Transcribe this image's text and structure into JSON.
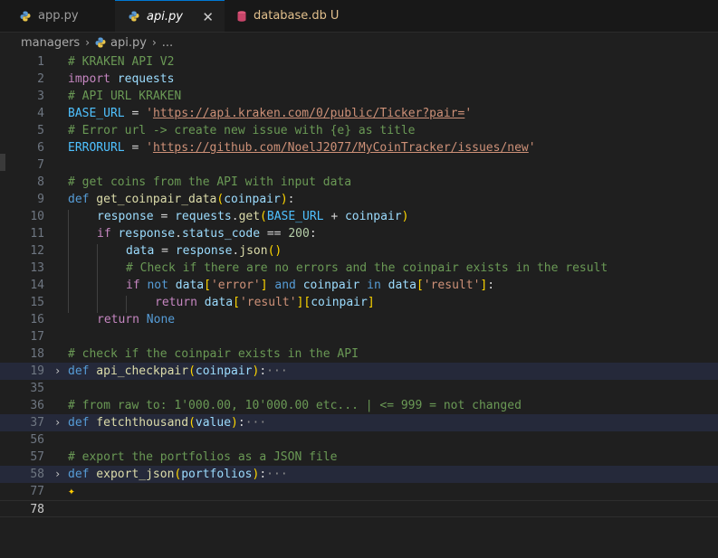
{
  "tabs": [
    {
      "label": "app.py",
      "icon": "python-icon"
    },
    {
      "label": "api.py",
      "icon": "python-icon",
      "close": "✕"
    },
    {
      "label": "database.db",
      "icon": "database-icon",
      "status": "U"
    }
  ],
  "breadcrumb": {
    "folder": "managers",
    "file": "api.py",
    "more": "..."
  },
  "lines": [
    {
      "n": "1"
    },
    {
      "n": "2"
    },
    {
      "n": "3"
    },
    {
      "n": "4"
    },
    {
      "n": "5"
    },
    {
      "n": "6"
    },
    {
      "n": "7"
    },
    {
      "n": "8"
    },
    {
      "n": "9"
    },
    {
      "n": "10"
    },
    {
      "n": "11"
    },
    {
      "n": "12"
    },
    {
      "n": "13"
    },
    {
      "n": "14"
    },
    {
      "n": "15"
    },
    {
      "n": "16"
    },
    {
      "n": "17"
    },
    {
      "n": "18"
    },
    {
      "n": "19"
    },
    {
      "n": "35"
    },
    {
      "n": "36"
    },
    {
      "n": "37"
    },
    {
      "n": "56"
    },
    {
      "n": "57"
    },
    {
      "n": "58"
    },
    {
      "n": "77"
    },
    {
      "n": "78"
    }
  ],
  "code": {
    "l1": "# KRAKEN API V2",
    "l2_kw": "import",
    "l2_mod": " requests",
    "l3": "# API URL KRAKEN",
    "l4_var": "BASE_URL",
    "l4_eq": " = ",
    "l4_q1": "'",
    "l4_url": "https://api.kraken.com/0/public/Ticker?pair=",
    "l4_q2": "'",
    "l5": "# Error url -> create new issue with {e} as title",
    "l6_var": "ERRORURL",
    "l6_eq": " = ",
    "l6_q1": "'",
    "l6_url": "https://github.com/NoelJ2077/MyCoinTracker/issues/new",
    "l6_q2": "'",
    "l8": "# get coins from the API with input data",
    "l9_def": "def",
    "l9_fn": " get_coinpair_data",
    "l9_p1": "(",
    "l9_arg": "coinpair",
    "l9_p2": ")",
    "l9_colon": ":",
    "l10_var": "response",
    "l10_eq": " = ",
    "l10_mod": "requests",
    "l10_dot": ".",
    "l10_fn": "get",
    "l10_p1": "(",
    "l10_cst": "BASE_URL",
    "l10_plus": " + ",
    "l10_arg": "coinpair",
    "l10_p2": ")",
    "l11_kw": "if",
    "l11_var": " response",
    "l11_dot": ".",
    "l11_attr": "status_code",
    "l11_eq": " == ",
    "l11_num": "200",
    "l11_colon": ":",
    "l12_var": "data",
    "l12_eq": " = ",
    "l12_obj": "response",
    "l12_dot": ".",
    "l12_fn": "json",
    "l12_p": "()",
    "l13": "# Check if there are no errors and the coinpair exists in the result",
    "l14_kw": "if",
    "l14_not": " not",
    "l14_data": " data",
    "l14_b1": "[",
    "l14_s1": "'error'",
    "l14_b2": "]",
    "l14_and": " and",
    "l14_arg": " coinpair",
    "l14_in": " in",
    "l14_data2": " data",
    "l14_b3": "[",
    "l14_s2": "'result'",
    "l14_b4": "]",
    "l14_colon": ":",
    "l15_kw": "return",
    "l15_data": " data",
    "l15_b1": "[",
    "l15_s": "'result'",
    "l15_b2": "]",
    "l15_b3": "[",
    "l15_arg": "coinpair",
    "l15_b4": "]",
    "l16_kw": "return",
    "l16_none": " None",
    "l18": "# check if the coinpair exists in the API",
    "l19_def": "def",
    "l19_fn": " api_checkpair",
    "l19_p1": "(",
    "l19_arg": "coinpair",
    "l19_p2": ")",
    "l19_colon": ":",
    "l19_ell": "···",
    "l36": "# from raw to: 1'000.00, 10'000.00 etc... | <= 999 = not changed",
    "l37_def": "def",
    "l37_fn": " fetchthousand",
    "l37_p1": "(",
    "l37_arg": "value",
    "l37_p2": ")",
    "l37_colon": ":",
    "l37_ell": "···",
    "l57": "# export the portfolios as a JSON file",
    "l58_def": "def",
    "l58_fn": " export_json",
    "l58_p1": "(",
    "l58_arg": "portfolios",
    "l58_p2": ")",
    "l58_colon": ":",
    "l58_ell": "···",
    "l77_icon": "✦"
  },
  "fold_chevron": "›",
  "colors": {
    "background": "#1f1f1f",
    "comment": "#6a9955",
    "keyword": "#c586c0",
    "string": "#ce9178",
    "function": "#dcdcaa",
    "variable": "#9cdcfe"
  }
}
